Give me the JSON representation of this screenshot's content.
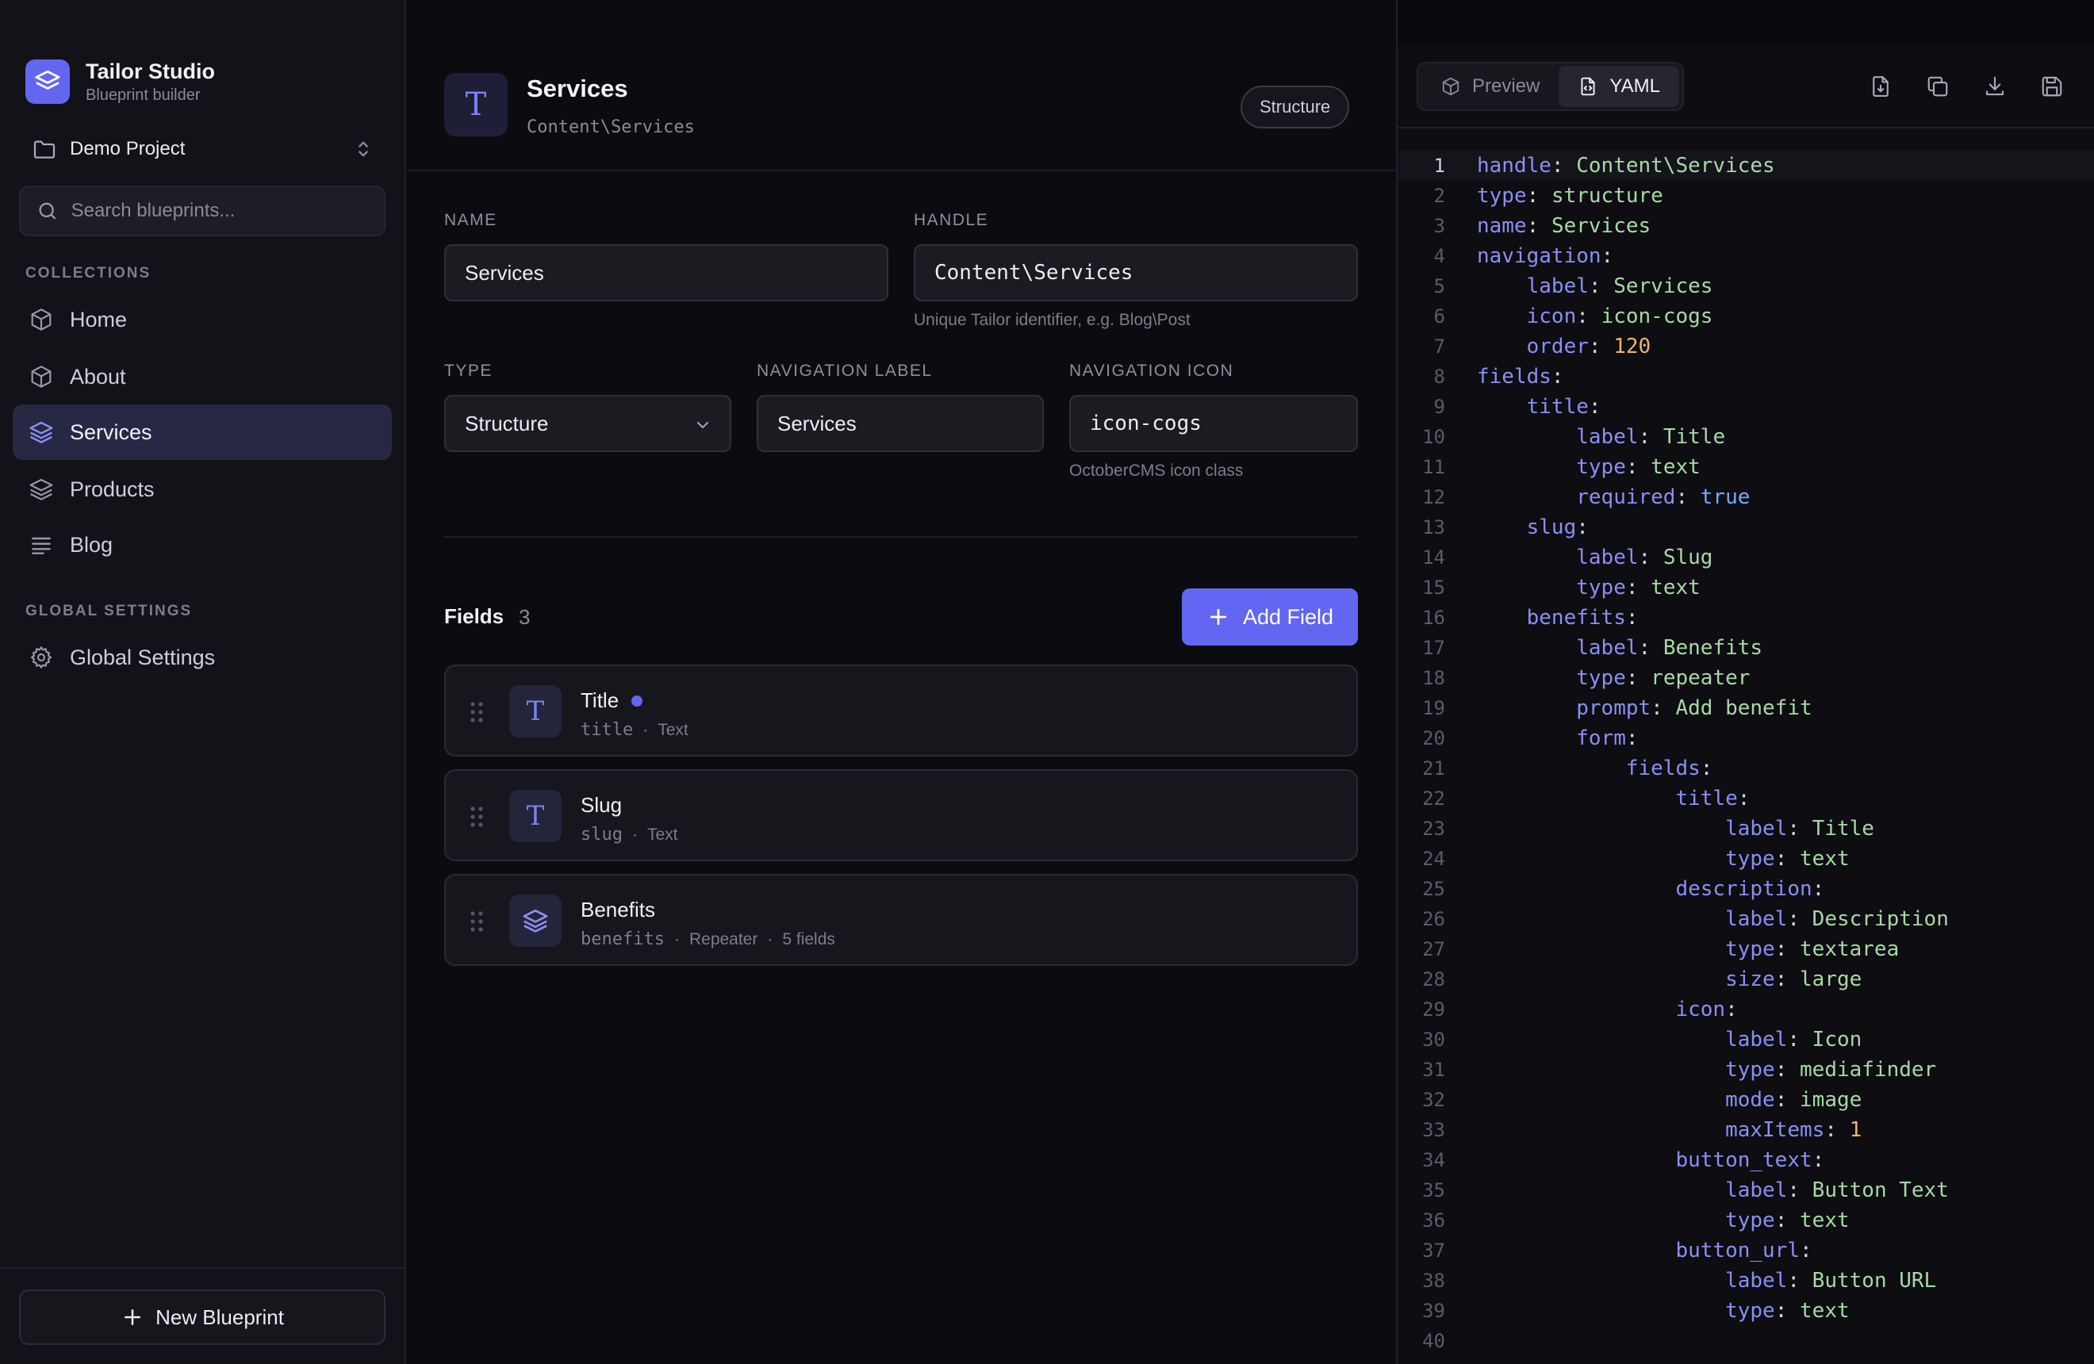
{
  "sidebar": {
    "brand_title": "Tailor Studio",
    "brand_subtitle": "Blueprint builder",
    "project": "Demo Project",
    "search_placeholder": "Search blueprints...",
    "collections_title": "COLLECTIONS",
    "collections": [
      {
        "label": "Home",
        "icon": "cube-icon",
        "active": false
      },
      {
        "label": "About",
        "icon": "cube-icon",
        "active": false
      },
      {
        "label": "Services",
        "icon": "layers-icon",
        "active": true
      },
      {
        "label": "Products",
        "icon": "layers-icon",
        "active": false
      },
      {
        "label": "Blog",
        "icon": "list-icon",
        "active": false
      }
    ],
    "global_title": "GLOBAL SETTINGS",
    "global_items": [
      {
        "label": "Global Settings",
        "icon": "gear-icon"
      }
    ],
    "new_blueprint": "New Blueprint"
  },
  "main": {
    "header_icon": "T",
    "title": "Services",
    "subtitle": "Content\\Services",
    "badge": "Structure",
    "form": {
      "name_label": "NAME",
      "name_value": "Services",
      "handle_label": "HANDLE",
      "handle_value": "Content\\Services",
      "handle_help": "Unique Tailor identifier, e.g. Blog\\Post",
      "type_label": "TYPE",
      "type_value": "Structure",
      "nav_label_label": "NAVIGATION LABEL",
      "nav_label_value": "Services",
      "nav_icon_label": "NAVIGATION ICON",
      "nav_icon_value": "icon-cogs",
      "nav_icon_help": "OctoberCMS icon class"
    },
    "fields_title": "Fields",
    "fields_count": "3",
    "add_field": "Add Field",
    "fields": [
      {
        "name": "Title",
        "handle": "title",
        "type": "Text",
        "extra": "",
        "icon": "T",
        "dot": true
      },
      {
        "name": "Slug",
        "handle": "slug",
        "type": "Text",
        "extra": "",
        "icon": "T",
        "dot": false
      },
      {
        "name": "Benefits",
        "handle": "benefits",
        "type": "Repeater",
        "extra": "5 fields",
        "icon": "layers-icon",
        "dot": false
      }
    ]
  },
  "yaml_panel": {
    "tabs": [
      {
        "label": "Preview",
        "icon": "cube-icon",
        "active": false
      },
      {
        "label": "YAML",
        "icon": "file-code-icon",
        "active": true
      }
    ],
    "toolbar_icons": [
      "file-download-icon",
      "copy-icon",
      "download-icon",
      "save-icon"
    ],
    "active_line": 1,
    "lines": [
      [
        [
          "k",
          "handle"
        ],
        [
          "p",
          ": "
        ],
        [
          "v",
          "Content\\Services"
        ]
      ],
      [
        [
          "k",
          "type"
        ],
        [
          "p",
          ": "
        ],
        [
          "v",
          "structure"
        ]
      ],
      [
        [
          "k",
          "name"
        ],
        [
          "p",
          ": "
        ],
        [
          "v",
          "Services"
        ]
      ],
      [
        [
          "k",
          "navigation"
        ],
        [
          "p",
          ":"
        ]
      ],
      [
        [
          "p",
          "    "
        ],
        [
          "k",
          "label"
        ],
        [
          "p",
          ": "
        ],
        [
          "v",
          "Services"
        ]
      ],
      [
        [
          "p",
          "    "
        ],
        [
          "k",
          "icon"
        ],
        [
          "p",
          ": "
        ],
        [
          "v",
          "icon-cogs"
        ]
      ],
      [
        [
          "p",
          "    "
        ],
        [
          "k",
          "order"
        ],
        [
          "p",
          ": "
        ],
        [
          "n",
          "120"
        ]
      ],
      [
        [
          "k",
          "fields"
        ],
        [
          "p",
          ":"
        ]
      ],
      [
        [
          "p",
          "    "
        ],
        [
          "k",
          "title"
        ],
        [
          "p",
          ":"
        ]
      ],
      [
        [
          "p",
          "        "
        ],
        [
          "k",
          "label"
        ],
        [
          "p",
          ": "
        ],
        [
          "v",
          "Title"
        ]
      ],
      [
        [
          "p",
          "        "
        ],
        [
          "k",
          "type"
        ],
        [
          "p",
          ": "
        ],
        [
          "v",
          "text"
        ]
      ],
      [
        [
          "p",
          "        "
        ],
        [
          "k",
          "required"
        ],
        [
          "p",
          ": "
        ],
        [
          "b",
          "true"
        ]
      ],
      [
        [
          "p",
          "    "
        ],
        [
          "k",
          "slug"
        ],
        [
          "p",
          ":"
        ]
      ],
      [
        [
          "p",
          "        "
        ],
        [
          "k",
          "label"
        ],
        [
          "p",
          ": "
        ],
        [
          "v",
          "Slug"
        ]
      ],
      [
        [
          "p",
          "        "
        ],
        [
          "k",
          "type"
        ],
        [
          "p",
          ": "
        ],
        [
          "v",
          "text"
        ]
      ],
      [
        [
          "p",
          "    "
        ],
        [
          "k",
          "benefits"
        ],
        [
          "p",
          ":"
        ]
      ],
      [
        [
          "p",
          "        "
        ],
        [
          "k",
          "label"
        ],
        [
          "p",
          ": "
        ],
        [
          "v",
          "Benefits"
        ]
      ],
      [
        [
          "p",
          "        "
        ],
        [
          "k",
          "type"
        ],
        [
          "p",
          ": "
        ],
        [
          "v",
          "repeater"
        ]
      ],
      [
        [
          "p",
          "        "
        ],
        [
          "k",
          "prompt"
        ],
        [
          "p",
          ": "
        ],
        [
          "v",
          "Add benefit"
        ]
      ],
      [
        [
          "p",
          "        "
        ],
        [
          "k",
          "form"
        ],
        [
          "p",
          ":"
        ]
      ],
      [
        [
          "p",
          "            "
        ],
        [
          "k",
          "fields"
        ],
        [
          "p",
          ":"
        ]
      ],
      [
        [
          "p",
          "                "
        ],
        [
          "k",
          "title"
        ],
        [
          "p",
          ":"
        ]
      ],
      [
        [
          "p",
          "                    "
        ],
        [
          "k",
          "label"
        ],
        [
          "p",
          ": "
        ],
        [
          "v",
          "Title"
        ]
      ],
      [
        [
          "p",
          "                    "
        ],
        [
          "k",
          "type"
        ],
        [
          "p",
          ": "
        ],
        [
          "v",
          "text"
        ]
      ],
      [
        [
          "p",
          "                "
        ],
        [
          "k",
          "description"
        ],
        [
          "p",
          ":"
        ]
      ],
      [
        [
          "p",
          "                    "
        ],
        [
          "k",
          "label"
        ],
        [
          "p",
          ": "
        ],
        [
          "v",
          "Description"
        ]
      ],
      [
        [
          "p",
          "                    "
        ],
        [
          "k",
          "type"
        ],
        [
          "p",
          ": "
        ],
        [
          "v",
          "textarea"
        ]
      ],
      [
        [
          "p",
          "                    "
        ],
        [
          "k",
          "size"
        ],
        [
          "p",
          ": "
        ],
        [
          "v",
          "large"
        ]
      ],
      [
        [
          "p",
          "                "
        ],
        [
          "k",
          "icon"
        ],
        [
          "p",
          ":"
        ]
      ],
      [
        [
          "p",
          "                    "
        ],
        [
          "k",
          "label"
        ],
        [
          "p",
          ": "
        ],
        [
          "v",
          "Icon"
        ]
      ],
      [
        [
          "p",
          "                    "
        ],
        [
          "k",
          "type"
        ],
        [
          "p",
          ": "
        ],
        [
          "v",
          "mediafinder"
        ]
      ],
      [
        [
          "p",
          "                    "
        ],
        [
          "k",
          "mode"
        ],
        [
          "p",
          ": "
        ],
        [
          "v",
          "image"
        ]
      ],
      [
        [
          "p",
          "                    "
        ],
        [
          "k",
          "maxItems"
        ],
        [
          "p",
          ": "
        ],
        [
          "n",
          "1"
        ]
      ],
      [
        [
          "p",
          "                "
        ],
        [
          "k",
          "button_text"
        ],
        [
          "p",
          ":"
        ]
      ],
      [
        [
          "p",
          "                    "
        ],
        [
          "k",
          "label"
        ],
        [
          "p",
          ": "
        ],
        [
          "v",
          "Button Text"
        ]
      ],
      [
        [
          "p",
          "                    "
        ],
        [
          "k",
          "type"
        ],
        [
          "p",
          ": "
        ],
        [
          "v",
          "text"
        ]
      ],
      [
        [
          "p",
          "                "
        ],
        [
          "k",
          "button_url"
        ],
        [
          "p",
          ":"
        ]
      ],
      [
        [
          "p",
          "                    "
        ],
        [
          "k",
          "label"
        ],
        [
          "p",
          ": "
        ],
        [
          "v",
          "Button URL"
        ]
      ],
      [
        [
          "p",
          "                    "
        ],
        [
          "k",
          "type"
        ],
        [
          "p",
          ": "
        ],
        [
          "v",
          "text"
        ]
      ],
      []
    ]
  }
}
